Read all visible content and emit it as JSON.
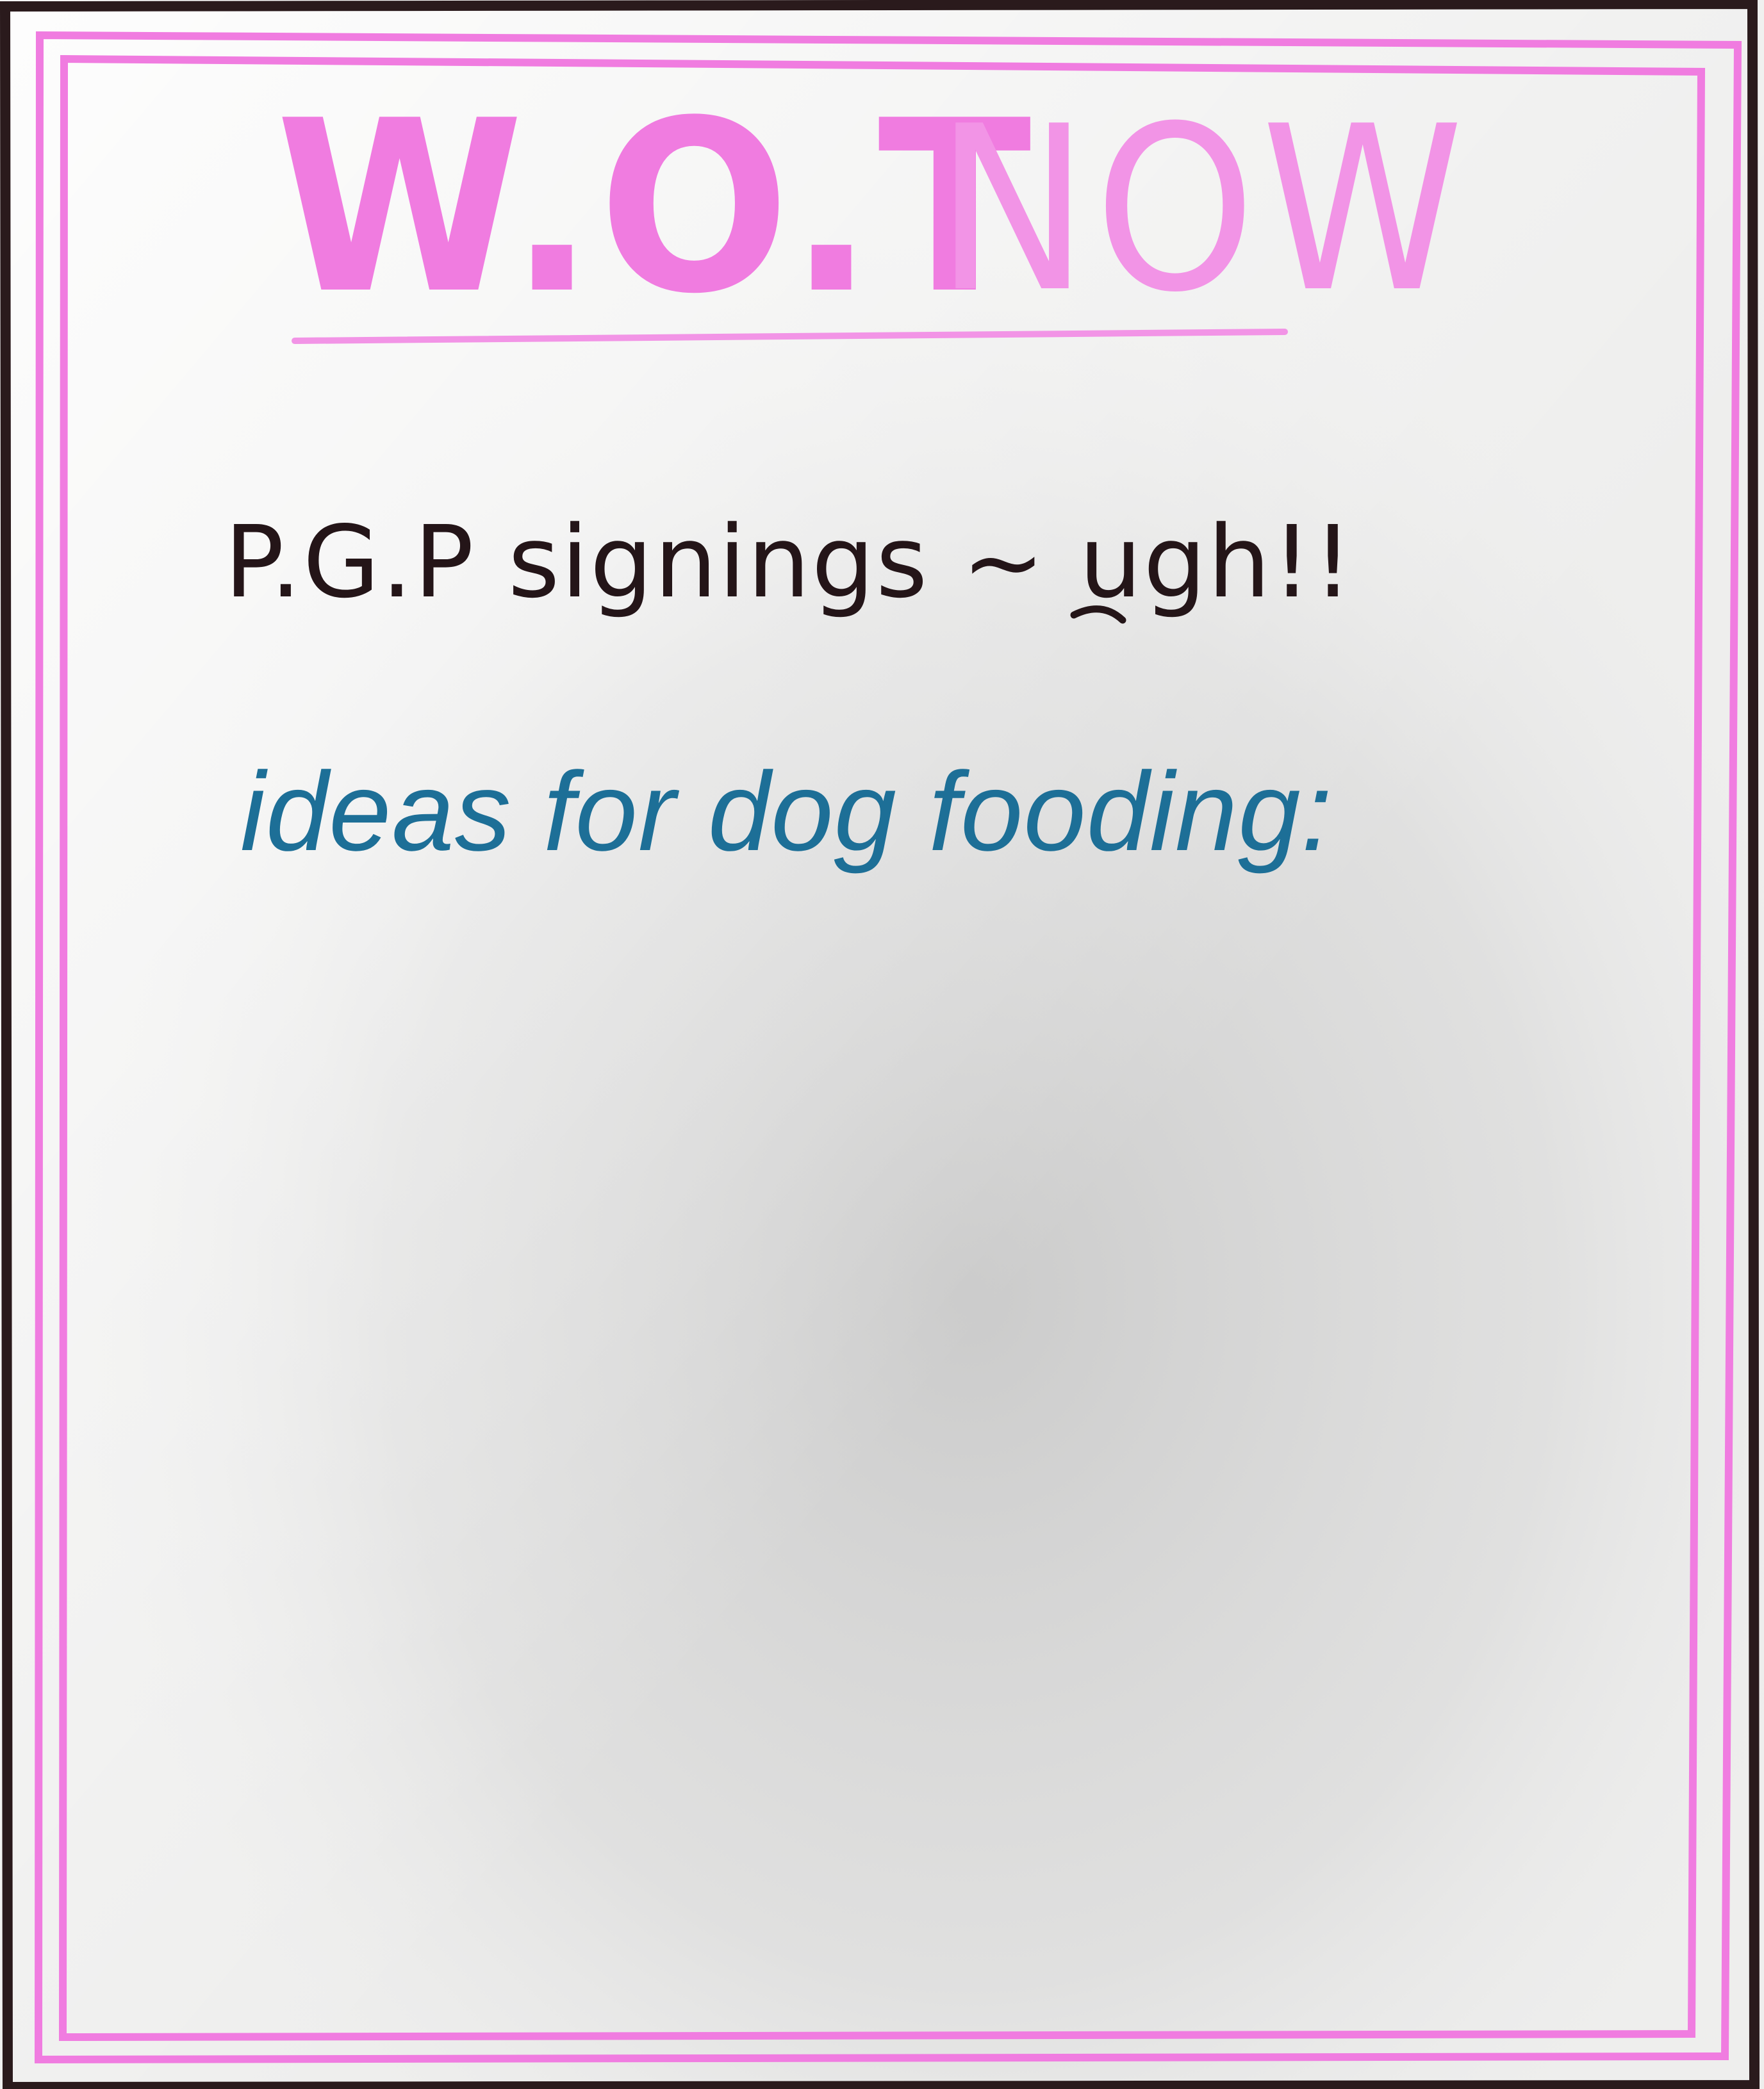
{
  "chart": {
    "title_part_1": "W.O.T",
    "title_part_2": "NOW",
    "line_1": "P.G.P signings ~ ugh!!",
    "line_2": "ideas for dog fooding:"
  },
  "colors": {
    "paper": "#f1f1f0",
    "pink_marker": "#f07ce0",
    "black_marker": "#241518",
    "blue_marker": "#1d6f97"
  },
  "icons": [
    "frown-face-icon"
  ]
}
